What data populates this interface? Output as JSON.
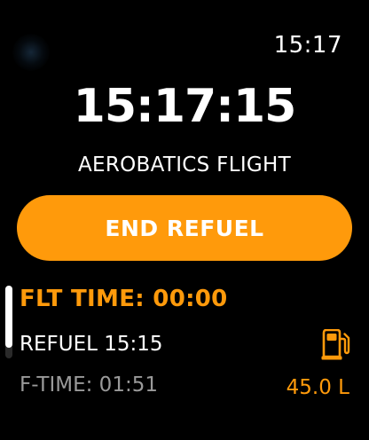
{
  "status_bar": {
    "clock": "15:17"
  },
  "main": {
    "big_time": "15:17:15",
    "mode_title": "AEROBATICS FLIGHT",
    "end_button_label": "END REFUEL"
  },
  "details": {
    "flt_time": "FLT TIME: 00:00",
    "refuel": "REFUEL 15:15",
    "f_time": "F-TIME: 01:51",
    "fuel_amount": "45.0 L",
    "fuel_icon": "fuel-pump-icon"
  },
  "colors": {
    "accent": "#ff9a0b",
    "background": "#000000",
    "secondary_text": "#9a9a9a"
  }
}
